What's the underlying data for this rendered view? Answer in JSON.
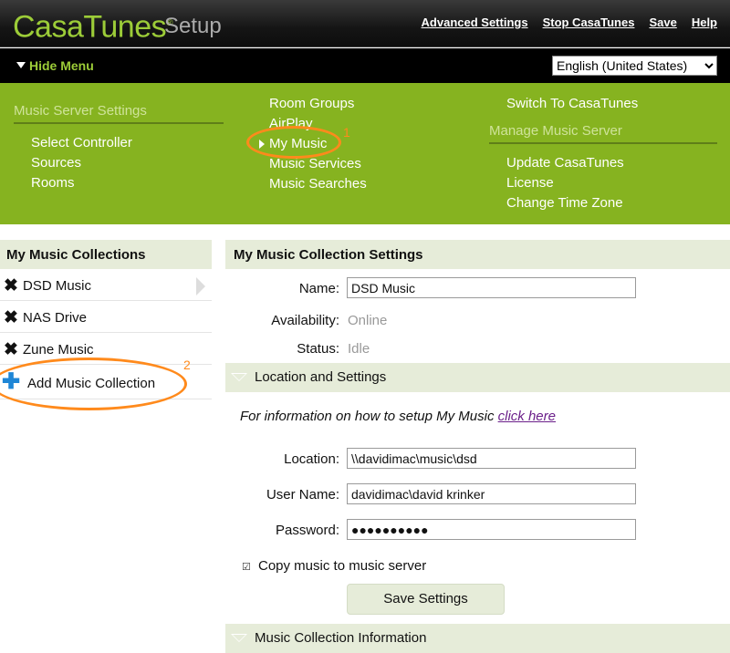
{
  "header": {
    "brand": "CasaTunes",
    "brand_mark": "®",
    "subtitle": "Setup",
    "links": [
      "Advanced Settings",
      "Stop CasaTunes",
      "Save",
      "Help"
    ]
  },
  "menubar": {
    "hide_menu": "Hide Menu",
    "language": "English (United States)",
    "language_options": [
      "English (United States)"
    ]
  },
  "nav": {
    "music_server_heading": "Music Server Settings",
    "col1_items": [
      "Select Controller",
      "Sources",
      "Rooms"
    ],
    "col2_items": [
      "Room Groups",
      "AirPlay",
      "My Music",
      "Music Services",
      "Music Searches"
    ],
    "col3_top": "Switch To CasaTunes",
    "manage_heading": "Manage Music Server",
    "col3_items": [
      "Update CasaTunes",
      "License",
      "Change Time Zone"
    ],
    "annotation_1": "1"
  },
  "collections": {
    "title": "My Music Collections",
    "items": [
      "DSD Music",
      "NAS Drive",
      "Zune Music"
    ],
    "add_label": "Add Music Collection",
    "annotation_2": "2"
  },
  "settings": {
    "title": "My Music Collection Settings",
    "name_label": "Name:",
    "name_value": "DSD Music",
    "availability_label": "Availability:",
    "availability_value": "Online",
    "status_label": "Status:",
    "status_value": "Idle",
    "location_section": "Location and Settings",
    "info_text": "For information on how to setup My Music ",
    "info_link": "click here",
    "location_label": "Location:",
    "location_value": "\\\\davidimac\\music\\dsd",
    "username_label": "User Name:",
    "username_value": "davidimac\\david krinker",
    "password_label": "Password:",
    "password_value": "●●●●●●●●●●",
    "copy_label": "Copy music to music server",
    "copy_checked": true,
    "save_button": "Save Settings",
    "info_section": "Music Collection Information"
  },
  "colors": {
    "brand_green": "#9ccc38",
    "menu_green": "#86b320",
    "annotation_orange": "#ff8a1c"
  }
}
